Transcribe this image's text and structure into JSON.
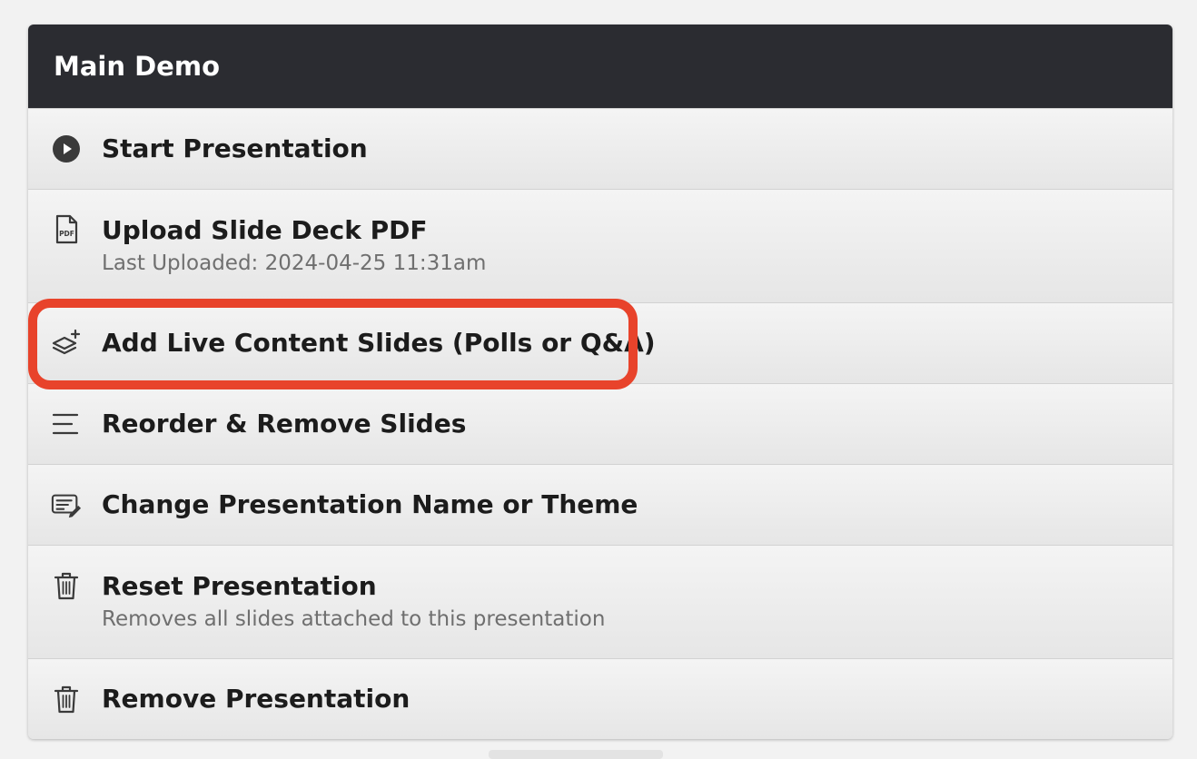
{
  "panel": {
    "title": "Main Demo"
  },
  "menu": {
    "items": [
      {
        "label": "Start Presentation",
        "icon": "play-circle-icon"
      },
      {
        "label": "Upload Slide Deck PDF",
        "sub": "Last Uploaded: 2024-04-25 11:31am",
        "icon": "pdf-file-icon"
      },
      {
        "label": "Add Live Content Slides (Polls or Q&A)",
        "icon": "layers-add-icon"
      },
      {
        "label": "Reorder & Remove Slides",
        "icon": "reorder-lines-icon"
      },
      {
        "label": "Change Presentation Name or Theme",
        "icon": "edit-text-icon"
      },
      {
        "label": "Reset Presentation",
        "sub": "Removes all slides attached to this presentation",
        "icon": "trash-icon"
      },
      {
        "label": "Remove Presentation",
        "icon": "trash-icon"
      }
    ]
  },
  "colors": {
    "header_bg": "#2b2c31",
    "highlight": "#e8432b",
    "text": "#1c1c1c",
    "subtext": "#6f6f6f"
  }
}
